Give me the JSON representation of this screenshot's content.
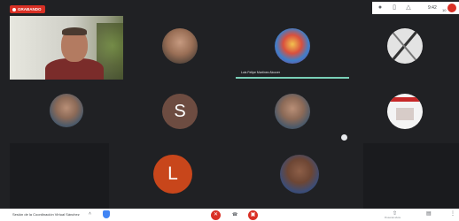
{
  "recording": {
    "label": "GRABANDO"
  },
  "topbar": {
    "people_icon": "people-icon",
    "chat_icon": "chat-icon",
    "activities_icon": "activities-icon",
    "time": "9:42",
    "participant_count": "10"
  },
  "tiles": {
    "letter_s": "S",
    "letter_l": "L"
  },
  "speaker": {
    "name": "Luis Felipe Martínez Alcocer"
  },
  "meeting": {
    "title": "Sesión de la Coordinación Virtual Sánchez"
  },
  "controls": {
    "mic_icon": "mic-off-icon",
    "hangup_icon": "hangup-icon",
    "cam_icon": "camera-off-icon",
    "present_label": "Presentar ahora",
    "more_label": "Más opciones"
  },
  "colors": {
    "background": "#202124",
    "danger": "#d93025",
    "accent": "#7ad0b8"
  }
}
